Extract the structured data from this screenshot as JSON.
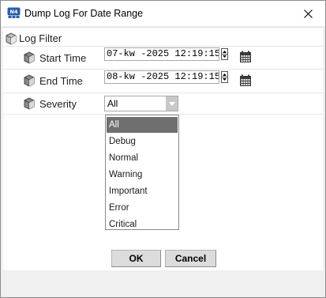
{
  "window": {
    "title": "Dump Log For Date Range",
    "app_icon_text": "N4",
    "close_glyph": "✕"
  },
  "log_filter": {
    "label": "Log Filter",
    "start_time": {
      "label": "Start Time",
      "value": "07-kw -2025 12:19:15"
    },
    "end_time": {
      "label": "End Time",
      "value": "08-kw -2025 12:19:15"
    },
    "severity": {
      "label": "Severity",
      "selected": "All",
      "options": [
        "All",
        "Debug",
        "Normal",
        "Warning",
        "Important",
        "Error",
        "Critical"
      ]
    }
  },
  "buttons": {
    "ok": "OK",
    "cancel": "Cancel"
  },
  "colors": {
    "selected_option_bg": "#6f6f6f",
    "icon_gray": "#7a7a7a",
    "calendar_dark": "#333333"
  },
  "icons": {
    "node": "cube-icon",
    "calendar": "calendar-icon",
    "spinner": "spinner-icon",
    "dropdown": "chevron-down-icon"
  }
}
